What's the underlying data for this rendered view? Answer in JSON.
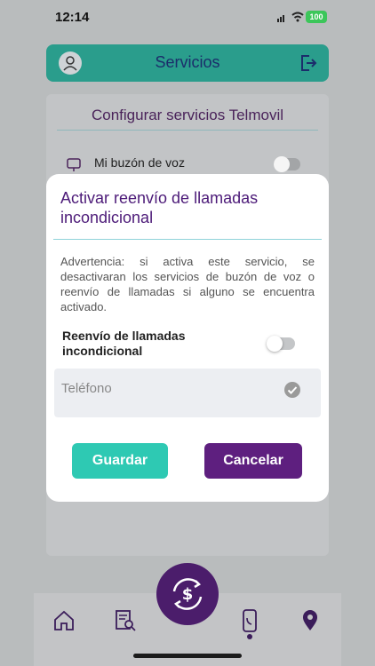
{
  "status": {
    "time": "12:14",
    "battery": "100"
  },
  "header": {
    "title": "Servicios"
  },
  "background": {
    "title": "Configurar servicios Telmovil",
    "row_label": "Mi buzón de voz"
  },
  "modal": {
    "title": "Activar reenvío de llamadas incondicional",
    "warning": "Advertencia: si activa este servicio, se desactivaran los servicios de buzón de voz o reenvío de llamadas si alguno se encuentra activado.",
    "toggle_label": "Reenvío de llamadas incondicional",
    "toggle_state": "off",
    "phone_placeholder": "Teléfono",
    "save_label": "Guardar",
    "cancel_label": "Cancelar"
  },
  "colors": {
    "header": "#2a9d8c",
    "title_purple": "#4c1a78",
    "save_button": "#2ec9b3",
    "cancel_button": "#5e1f7f"
  },
  "icons": [
    "user-icon",
    "logout-icon",
    "voicemail-icon",
    "check-circle-icon",
    "home-icon",
    "document-search-icon",
    "payment-icon",
    "phone-icon",
    "location-icon"
  ]
}
